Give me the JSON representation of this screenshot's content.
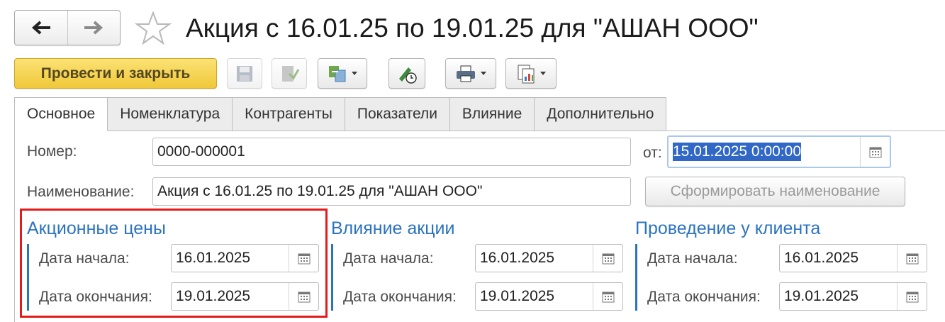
{
  "header": {
    "back_icon": "arrow-left-icon",
    "forward_icon": "arrow-right-icon",
    "favorite_icon": "star-outline-icon",
    "title": "Акция с 16.01.25 по 19.01.25 для \"АШАН ООО\""
  },
  "toolbar": {
    "post_and_close_label": "Провести и закрыть",
    "icons": [
      "save-icon",
      "post-document-icon",
      "create-based-on-icon",
      "edit-history-icon",
      "print-icon",
      "reports-icon"
    ]
  },
  "tabs": [
    {
      "label": "Основное",
      "active": true
    },
    {
      "label": "Номенклатура",
      "active": false
    },
    {
      "label": "Контрагенты",
      "active": false
    },
    {
      "label": "Показатели",
      "active": false
    },
    {
      "label": "Влияние",
      "active": false
    },
    {
      "label": "Дополнительно",
      "active": false
    }
  ],
  "form": {
    "number_label": "Номер:",
    "number_value": "0000-000001",
    "from_label": "от:",
    "from_value": "15.01.2025  0:00:00",
    "name_label": "Наименование:",
    "name_value": "Акция с 16.01.25 по 19.01.25 для \"АШАН ООО\"",
    "generate_name_label": "Сформировать наименование"
  },
  "groups": [
    {
      "title": "Акционные цены",
      "start_label": "Дата начала:",
      "start_value": "16.01.2025",
      "end_label": "Дата окончания:",
      "end_value": "19.01.2025"
    },
    {
      "title": "Влияние акции",
      "start_label": "Дата начала:",
      "start_value": "16.01.2025",
      "end_label": "Дата окончания:",
      "end_value": "19.01.2025"
    },
    {
      "title": "Проведение у клиента",
      "start_label": "Дата начала:",
      "start_value": "16.01.2025",
      "end_label": "Дата окончания:",
      "end_value": "19.01.2025"
    }
  ],
  "colors": {
    "accent": "#2b73c0",
    "primary_button": "#f3cf4a",
    "highlight_box": "#e41b1b",
    "selection": "#3168c5"
  }
}
